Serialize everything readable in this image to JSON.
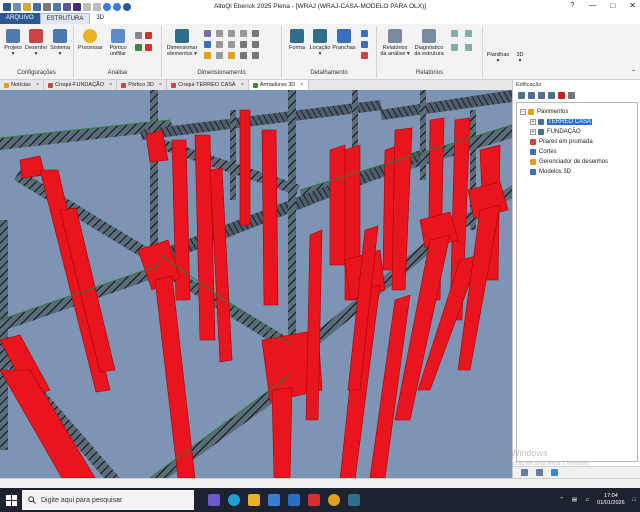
{
  "window": {
    "title": "AltoQi Eberick 2025 Plena - [WRAJ (WRAJ-CASA-MODELO PARA OLX)]",
    "controls": [
      "minimize-icon",
      "maximize-icon",
      "close-icon"
    ],
    "help_glyph": "?"
  },
  "ribbon_tabs": [
    {
      "label": "ARQUIVO"
    },
    {
      "label": "ESTRUTURA"
    },
    {
      "label": "3D"
    }
  ],
  "ribbon": {
    "groups": [
      {
        "label": "Configurações",
        "buttons": [
          "Projeto",
          "Desenho",
          "Sistema"
        ]
      },
      {
        "label": "Análise",
        "buttons": [
          "Processar",
          "Pórtico unifilar"
        ]
      },
      {
        "label": "Dimensionamento",
        "buttons": [
          "Dimensionar elementos"
        ]
      },
      {
        "label": "Detalhamento",
        "buttons": [
          "Forma",
          "Locação",
          "Pranchas"
        ]
      },
      {
        "label": "Relatórios",
        "buttons": [
          "Relatórios da análise",
          "Diagnóstico da estrutura"
        ]
      },
      {
        "label": "",
        "buttons": [
          "Planilhas",
          "3D"
        ]
      }
    ]
  },
  "doc_tabs": [
    {
      "label": "Notícias",
      "active": false
    },
    {
      "label": "Croqui-FUNDAÇÃO",
      "active": false
    },
    {
      "label": "Pórtico 3D",
      "active": false
    },
    {
      "label": "Croqui-TERREO CASA",
      "active": false
    },
    {
      "label": "Armaduras 3D",
      "active": true
    }
  ],
  "side_panel": {
    "title": "Edificação",
    "tree": {
      "root": "Pavimentos",
      "floors": [
        "TERREO CASA",
        "FUNDAÇÃO"
      ],
      "selected": "TERREO CASA",
      "others": [
        "Pilares em prumada",
        "Cortes",
        "Gerenciador de desenhos",
        "Modelos 3D"
      ]
    }
  },
  "watermark": {
    "line1": "Ativar o Windows",
    "line2": "Acesse Configurações para ativar o Windows."
  },
  "taskbar": {
    "search_placeholder": "Digite aqui para pesquisar",
    "time": "17:04",
    "date": "01/01/2026"
  },
  "colors": {
    "ribbon_file_tab": "#2b5797",
    "viewport_bg": "#7d94b5",
    "column_red": "#e8141e",
    "rebar_dark": "#2a2a2a",
    "tree_selected": "#2a6fd6",
    "taskbar": "#1c2230"
  }
}
